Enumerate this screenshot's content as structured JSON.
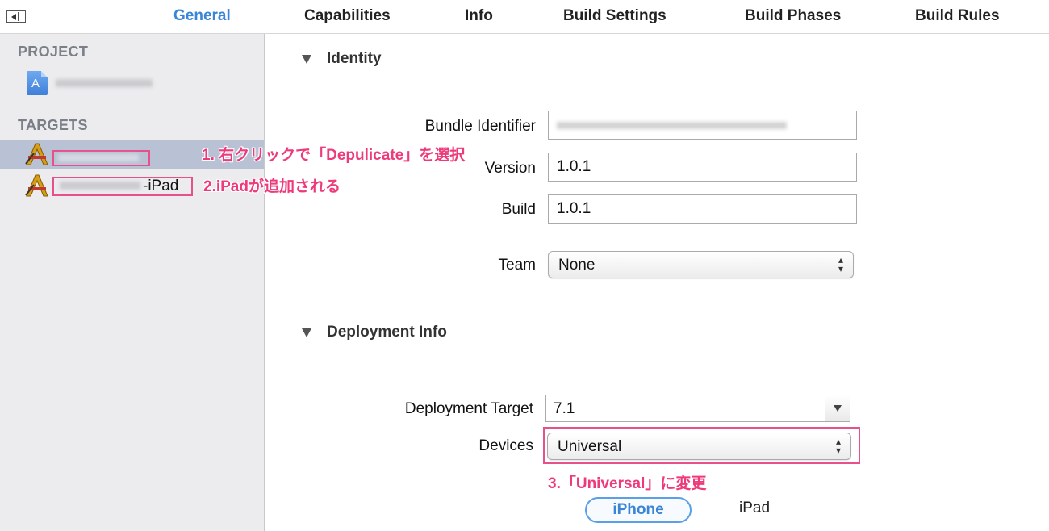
{
  "tabs": [
    {
      "label": "General",
      "active": true
    },
    {
      "label": "Capabilities"
    },
    {
      "label": "Info"
    },
    {
      "label": "Build Settings"
    },
    {
      "label": "Build Phases"
    },
    {
      "label": "Build Rules"
    }
  ],
  "sidebar": {
    "project_header": "PROJECT",
    "targets_header": "TARGETS",
    "second_target_suffix": "-iPad"
  },
  "annotations": {
    "step1": "1. 右クリックで「Depulicate」を選択",
    "step2": "2.iPadが追加される",
    "step3": "3.「Universal」に変更"
  },
  "identity": {
    "title": "Identity",
    "bundle_identifier_label": "Bundle Identifier",
    "version_label": "Version",
    "version_value": "1.0.1",
    "build_label": "Build",
    "build_value": "1.0.1",
    "team_label": "Team",
    "team_value": "None"
  },
  "deployment": {
    "title": "Deployment Info",
    "target_label": "Deployment Target",
    "target_value": "7.1",
    "devices_label": "Devices",
    "devices_value": "Universal",
    "device_tabs": [
      "iPhone",
      "iPad"
    ]
  },
  "colors": {
    "accent": "#3a85d6",
    "annotation": "#ee3a7a",
    "selection": "#b8c2d4"
  }
}
